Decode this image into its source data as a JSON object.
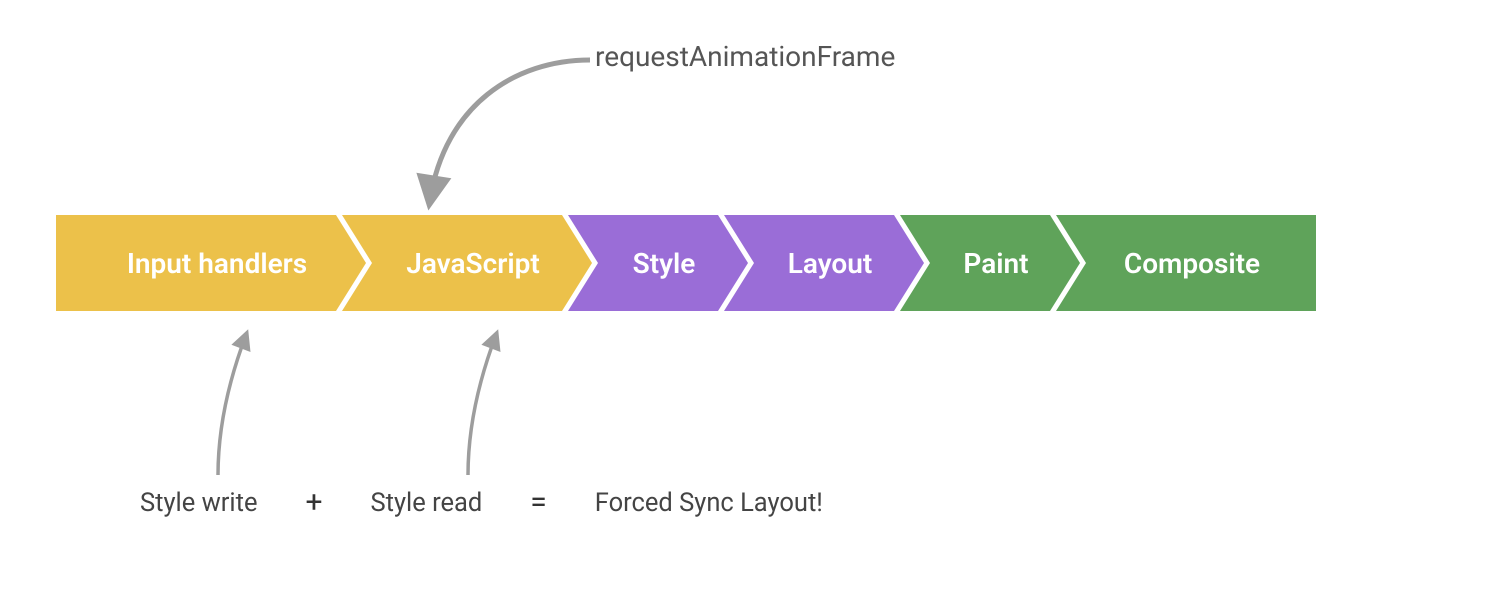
{
  "annotations": {
    "top": "requestAnimationFrame",
    "bottom": {
      "left": "Style write",
      "op_plus": "+",
      "right": "Style read",
      "op_eq": "=",
      "result": "Forced Sync Layout!"
    }
  },
  "pipeline": {
    "stages": [
      {
        "id": "input-handlers",
        "label": "Input handlers",
        "color": "#ECC14A"
      },
      {
        "id": "javascript",
        "label": "JavaScript",
        "color": "#ECC14A"
      },
      {
        "id": "style",
        "label": "Style",
        "color": "#9A6DD7"
      },
      {
        "id": "layout",
        "label": "Layout",
        "color": "#9A6DD7"
      },
      {
        "id": "paint",
        "label": "Paint",
        "color": "#5FA35A"
      },
      {
        "id": "composite",
        "label": "Composite",
        "color": "#5FA35A"
      }
    ]
  },
  "colors": {
    "arrow": "#9d9d9d",
    "text_muted": "#555"
  }
}
